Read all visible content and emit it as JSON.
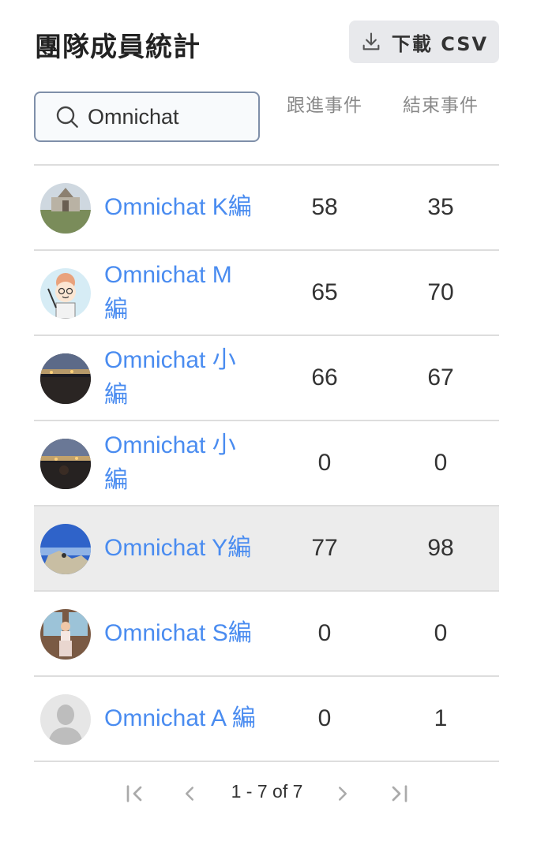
{
  "header": {
    "title": "團隊成員統計",
    "csv_label": "下載 CSV"
  },
  "search": {
    "value": "Omnichat"
  },
  "columns": {
    "follow": "跟進事件",
    "closed": "結束事件"
  },
  "rows": [
    {
      "name": "Omnichat K編",
      "follow": "58",
      "closed": "35",
      "avatar": "building-photo"
    },
    {
      "name": "Omnichat M 編",
      "follow": "65",
      "closed": "70",
      "avatar": "cartoon-girl"
    },
    {
      "name": "Omnichat 小 編",
      "follow": "66",
      "closed": "67",
      "avatar": "night-city-photo"
    },
    {
      "name": "Omnichat 小 編",
      "follow": "0",
      "closed": "0",
      "avatar": "night-city-photo"
    },
    {
      "name": "Omnichat Y編",
      "follow": "77",
      "closed": "98",
      "avatar": "mountain-photo"
    },
    {
      "name": "Omnichat S編",
      "follow": "0",
      "closed": "0",
      "avatar": "person-photo"
    },
    {
      "name": "Omnichat A 編",
      "follow": "0",
      "closed": "1",
      "avatar": "default-avatar"
    }
  ],
  "pagination": {
    "info": "1 - 7 of 7"
  },
  "colors": {
    "link": "#4a8cf0",
    "highlight_row": "#ececec"
  }
}
